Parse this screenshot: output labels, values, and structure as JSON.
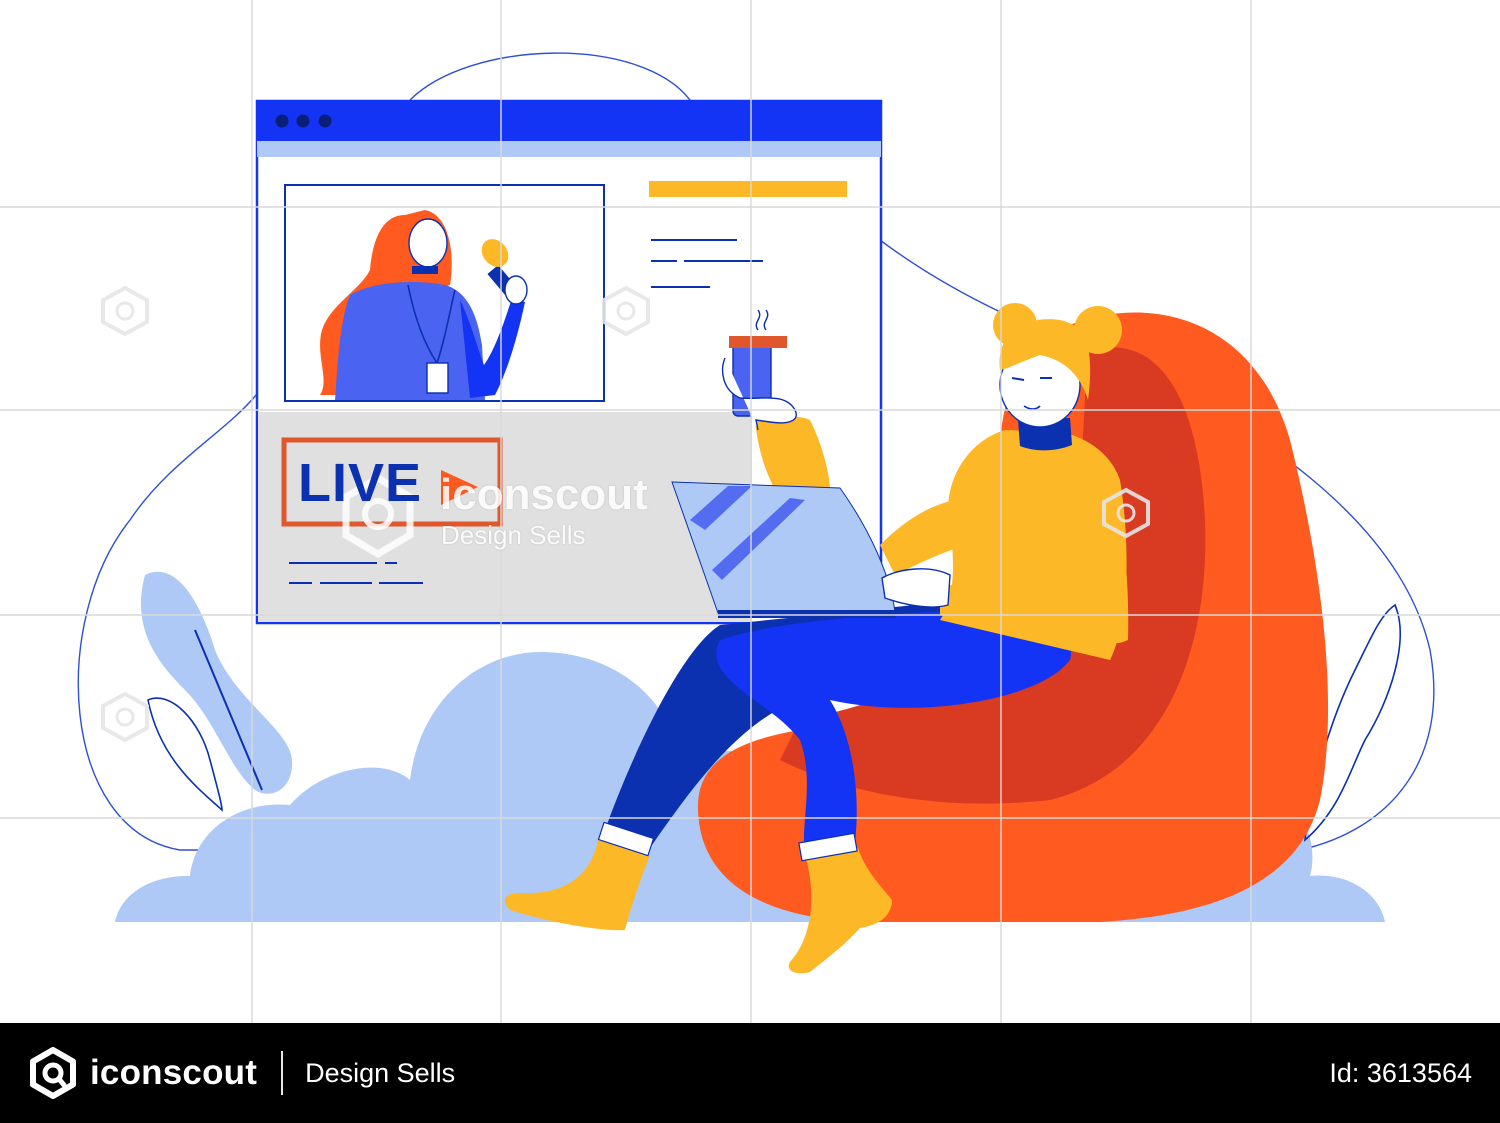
{
  "illustration": {
    "live_badge": "LIVE"
  },
  "watermark": {
    "brand": "iconscout",
    "tagline": "Design Sells"
  },
  "footer": {
    "brand": "iconscout",
    "tagline": "Design Sells",
    "asset_id": "Id: 3613564"
  },
  "colors": {
    "brand_blue": "#1434f5",
    "orange": "#ff5a1f",
    "dark_orange": "#d83a22",
    "yellow": "#fdb827",
    "navy": "#0b30b0",
    "light_blue": "#aec9f5",
    "footer_bg": "#000000"
  }
}
